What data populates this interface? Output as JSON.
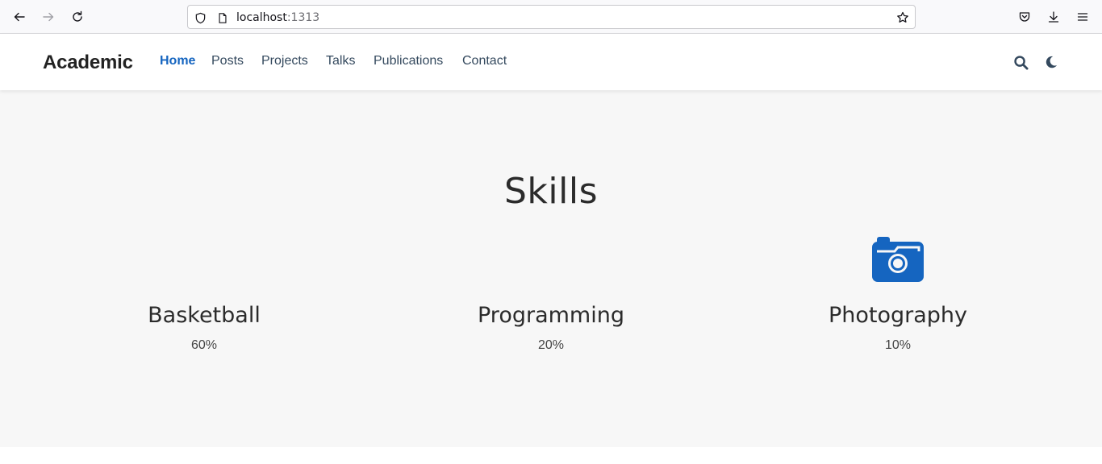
{
  "browser": {
    "url_host": "localhost",
    "url_port": ":1313"
  },
  "navbar": {
    "brand": "Academic",
    "items": [
      {
        "label": "Home",
        "active": true
      },
      {
        "label": "Posts"
      },
      {
        "label": "Projects"
      },
      {
        "label": "Talks"
      },
      {
        "label": "Publications"
      },
      {
        "label": "Contact"
      }
    ],
    "icons": [
      "search-icon",
      "moon-icon"
    ],
    "accent_color": "#1565c0"
  },
  "skills": {
    "title": "Skills",
    "items": [
      {
        "name": "Basketball",
        "description": "60%",
        "icon": "basketball-icon"
      },
      {
        "name": "Programming",
        "description": "20%",
        "icon": "code-icon"
      },
      {
        "name": "Photography",
        "description": "10%",
        "icon": "camera-retro-icon",
        "icon_color": "#1565c0"
      }
    ]
  }
}
